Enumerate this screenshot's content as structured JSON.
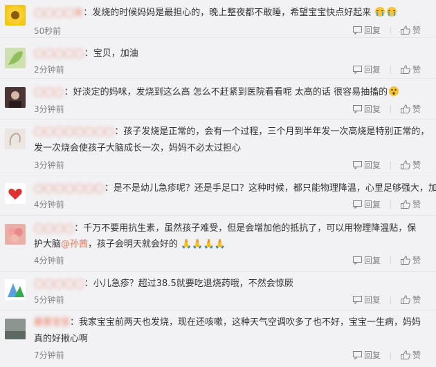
{
  "comments": [
    {
      "user": "◯◯◯◯女",
      "lines": [
        "发烧的时候妈妈是最担心的，晚上整夜都不敢睡，希望宝宝快点好起来"
      ],
      "time": "50秒前",
      "reply": "回复",
      "like": "赞",
      "avatar": "sunflower"
    },
    {
      "user": "◯◯◯◯◯",
      "lines": [
        "宝贝，加油"
      ],
      "time": "2分钟前",
      "reply": "回复",
      "like": "赞",
      "avatar": "leaf"
    },
    {
      "user": "◯◯◯",
      "lines": [
        "好淡定的妈咪，发烧到这么高 怎么不赶紧到医院看看呢 太高的话 很容易抽搐的"
      ],
      "time": "3分钟前",
      "reply": "回复",
      "like": "赞",
      "avatar": "portrait"
    },
    {
      "user": "◯◯◯◯◯◯◯◯",
      "lines": [
        "孩子发烧是正常的，会有一个过程，三个月到半年发一次高烧是特别正常的，",
        "发一次烧会使孩子大脑成长一次，妈妈不必太过担心"
      ],
      "time": "3分钟前",
      "reply": "回复",
      "like": "赞",
      "avatar": "sketch"
    },
    {
      "user": "◯◯◯◯◯◯◯",
      "lines": [
        "是不是幼儿急疹呢？还是手足口？这种时候，都只能物理降温，心里足够强大，加油！"
      ],
      "time": "4分钟前",
      "reply": "回复",
      "like": "赞",
      "avatar": "heart"
    },
    {
      "user": "◯◯◯◯",
      "lines": [
        "千万不要用抗生素，虽然孩子难受，但是会增加他的抵抗了，可以用物理降温贴，保",
        "护大脑",
        "孩子会明天就会好的"
      ],
      "mention": "@孙茜",
      "time": "4分钟前",
      "reply": "回复",
      "like": "赞",
      "avatar": "flowers"
    },
    {
      "user": "◯◯◯◯◯",
      "lines": [
        "小儿急疹？超过38.5就要吃退烧药哦，不然会惊厥"
      ],
      "time": "5分钟前",
      "reply": "回复",
      "like": "赞",
      "avatar": "cartoon"
    },
    {
      "user": "最爱宝宝",
      "lines": [
        "我家宝宝前两天也发烧，现在还咳嗽，这种天气空调吹多了也不好，宝宝一生病，妈妈",
        "真的好揪心啊"
      ],
      "time": "7分钟前",
      "reply": "回复",
      "like": "赞",
      "avatar": "scene"
    }
  ],
  "icons": {
    "reply": "reply-icon",
    "like": "thumbs-up-icon"
  },
  "colors": {
    "username": "#eb7350",
    "text": "#333333",
    "meta": "#808080",
    "background": "#f2f2f5"
  }
}
